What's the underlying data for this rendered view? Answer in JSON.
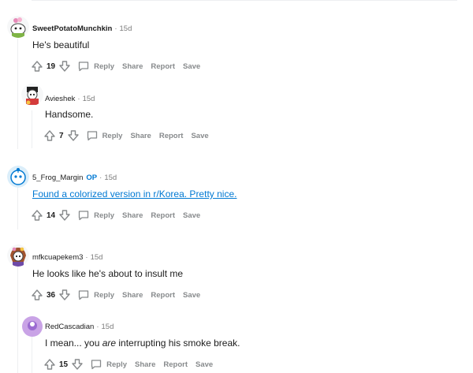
{
  "comments": [
    {
      "author": "SweetPotatoMunchkin",
      "op": "",
      "time": "15d",
      "text": "He's beautiful",
      "score": "19"
    },
    {
      "author": "Avieshek",
      "op": "",
      "time": "15d",
      "text": "Handsome.",
      "score": "7"
    },
    {
      "author": "5_Frog_Margin",
      "op": "OP",
      "time": "15d",
      "text": "Found a colorized version in r/Korea. Pretty nice.",
      "score": "14"
    },
    {
      "author": "mfkcuapekem3",
      "op": "",
      "time": "15d",
      "text": "He looks like he's about to insult me",
      "score": "36"
    },
    {
      "author": "RedCascadian",
      "op": "",
      "time": "15d",
      "text_before": "I mean... you ",
      "text_em": "are",
      "text_after": " interrupting his smoke break.",
      "score": "15"
    }
  ],
  "labels": {
    "reply": "Reply",
    "share": "Share",
    "report": "Report",
    "save": "Save",
    "dot": "·"
  },
  "colors": {
    "link": "#0079d3",
    "meta": "#7c7c7c",
    "action": "#878a8c",
    "thread": "#edeff1"
  },
  "icons": [
    "upvote-icon",
    "downvote-icon",
    "reply-icon"
  ]
}
